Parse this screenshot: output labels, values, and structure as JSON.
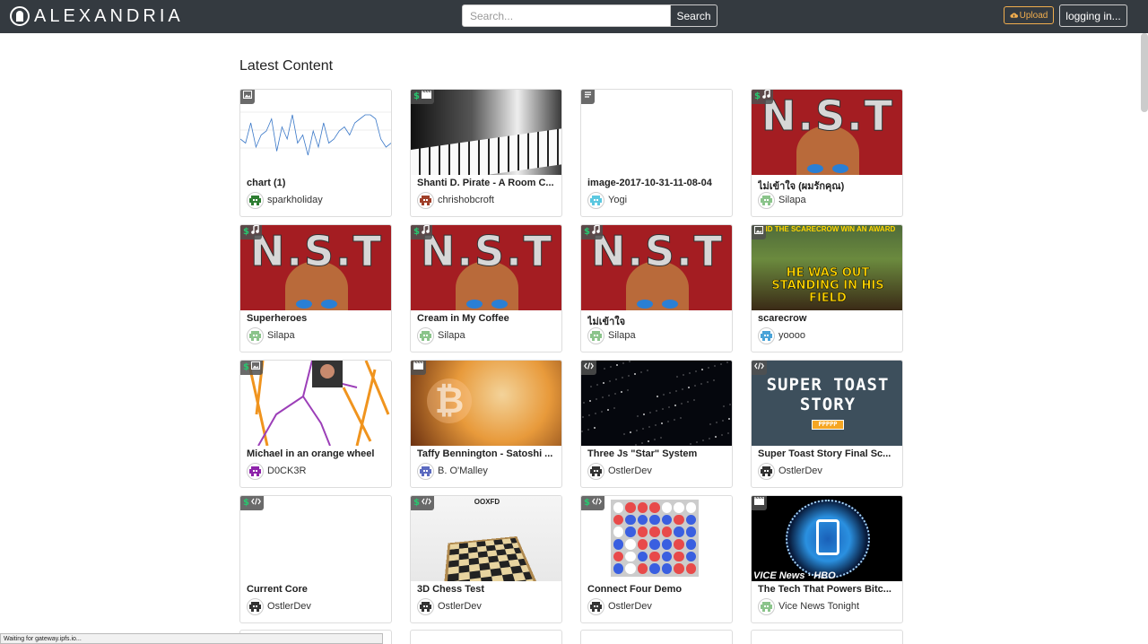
{
  "navbar": {
    "brand": "ALEXANDRIA",
    "search": {
      "placeholder": "Search...",
      "value": "",
      "button_label": "Search"
    },
    "upload_label": "Upload",
    "login_label": "logging in..."
  },
  "main": {
    "title": "Latest Content"
  },
  "cards": [
    {
      "title": "chart (1)",
      "author": "sparkholiday",
      "badges": [
        "image-icon"
      ],
      "thumb": "chart",
      "avatar_color": "#2e7d32"
    },
    {
      "title": "Shanti D. Pirate - A Room C...",
      "author": "chrishobcroft",
      "badges": [
        "$",
        "video-icon"
      ],
      "thumb": "piano",
      "avatar_color": "#a0402a"
    },
    {
      "title": "image-2017-10-31-11-08-04",
      "author": "Yogi",
      "badges": [
        "text-icon"
      ],
      "thumb": "blank",
      "avatar_color": "#5cc8e0"
    },
    {
      "title": "ไม่เข้าใจ (ผมรักคุณ)",
      "author": "Silapa",
      "badges": [
        "$",
        "music-icon"
      ],
      "thumb": "nst",
      "avatar_color": "#8bc48b"
    },
    {
      "title": "Superheroes",
      "author": "Silapa",
      "badges": [
        "$",
        "music-icon"
      ],
      "thumb": "nst",
      "avatar_color": "#8bc48b"
    },
    {
      "title": "Cream in My Coffee",
      "author": "Silapa",
      "badges": [
        "$",
        "music-icon"
      ],
      "thumb": "nst",
      "avatar_color": "#8bc48b"
    },
    {
      "title": "ไม่เข้าใจ",
      "author": "Silapa",
      "badges": [
        "$",
        "music-icon"
      ],
      "thumb": "nst",
      "avatar_color": "#8bc48b"
    },
    {
      "title": "scarecrow",
      "author": "yoooo",
      "badges": [
        "image-icon"
      ],
      "thumb": "field",
      "avatar_color": "#4aa3d8",
      "thumb_top": "DID THE SCARECROW WIN AN AWARD",
      "thumb_caption": "HE WAS OUT STANDING IN HIS FIELD"
    },
    {
      "title": "Michael in an orange wheel",
      "author": "D0CK3R",
      "badges": [
        "$",
        "image-icon"
      ],
      "thumb": "orange",
      "avatar_color": "#8e24aa"
    },
    {
      "title": "Taffy Bennington - Satoshi ...",
      "author": "B. O'Malley",
      "badges": [
        "video-icon"
      ],
      "thumb": "taffy",
      "avatar_color": "#5c6bc0"
    },
    {
      "title": "Three Js \"Star\" System",
      "author": "OstlerDev",
      "badges": [
        "code-icon"
      ],
      "thumb": "stars",
      "avatar_color": "#333333"
    },
    {
      "title": "Super Toast Story Final Sc...",
      "author": "OstlerDev",
      "badges": [
        "code-icon"
      ],
      "thumb": "toast",
      "avatar_color": "#333333",
      "thumb_line1": "SUPER TOAST",
      "thumb_line2": "STORY",
      "thumb_bar": "PPPPP"
    },
    {
      "title": "Current Core",
      "author": "OstlerDev",
      "badges": [
        "$",
        "code-icon"
      ],
      "thumb": "blank",
      "avatar_color": "#333333"
    },
    {
      "title": "3D Chess Test",
      "author": "OstlerDev",
      "badges": [
        "$",
        "code-icon"
      ],
      "thumb": "chess",
      "avatar_color": "#333333",
      "thumb_header": "OOXFD"
    },
    {
      "title": "Connect Four Demo",
      "author": "OstlerDev",
      "badges": [
        "$",
        "code-icon"
      ],
      "thumb": "c4",
      "avatar_color": "#333333"
    },
    {
      "title": "The Tech That Powers Bitc...",
      "author": "Vice News Tonight",
      "badges": [
        "video-icon"
      ],
      "thumb": "news",
      "avatar_color": "#8bc48b",
      "thumb_label": "VICE News · HBO"
    }
  ],
  "status_bar": "Waiting for gateway.ipfs.io..."
}
